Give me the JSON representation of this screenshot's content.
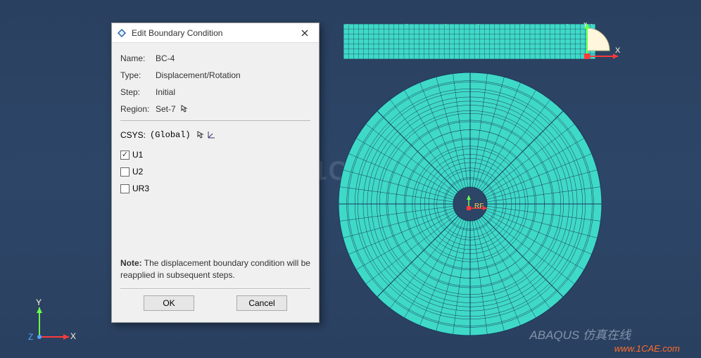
{
  "dialog": {
    "title": "Edit Boundary Condition",
    "fields": {
      "name": {
        "label": "Name:",
        "value": "BC-4"
      },
      "type": {
        "label": "Type:",
        "value": "Displacement/Rotation"
      },
      "step": {
        "label": "Step:",
        "value": "Initial"
      },
      "region": {
        "label": "Region:",
        "value": "Set-7"
      }
    },
    "csys": {
      "label": "CSYS:",
      "value": "(Global)"
    },
    "checks": {
      "u1": {
        "label": "U1",
        "checked": true
      },
      "u2": {
        "label": "U2",
        "checked": false
      },
      "ur3": {
        "label": "UR3",
        "checked": false
      }
    },
    "note": {
      "prefix": "Note:",
      "body": "The displacement boundary condition will be reapplied in subsequent steps."
    },
    "buttons": {
      "ok": "OK",
      "cancel": "Cancel"
    }
  },
  "triad": {
    "x": "X",
    "y": "Y",
    "z": "Z"
  },
  "view_ori": {
    "x": "X",
    "y": "Y"
  },
  "watermark": "1CAE",
  "brand_watermark": "ABAQUS 仿真在线",
  "url_watermark": "www.1CAE.com",
  "center_rf": "RF",
  "colors": {
    "mesh_fill": "#3fd9c7",
    "mesh_line": "#1a3b5c"
  }
}
